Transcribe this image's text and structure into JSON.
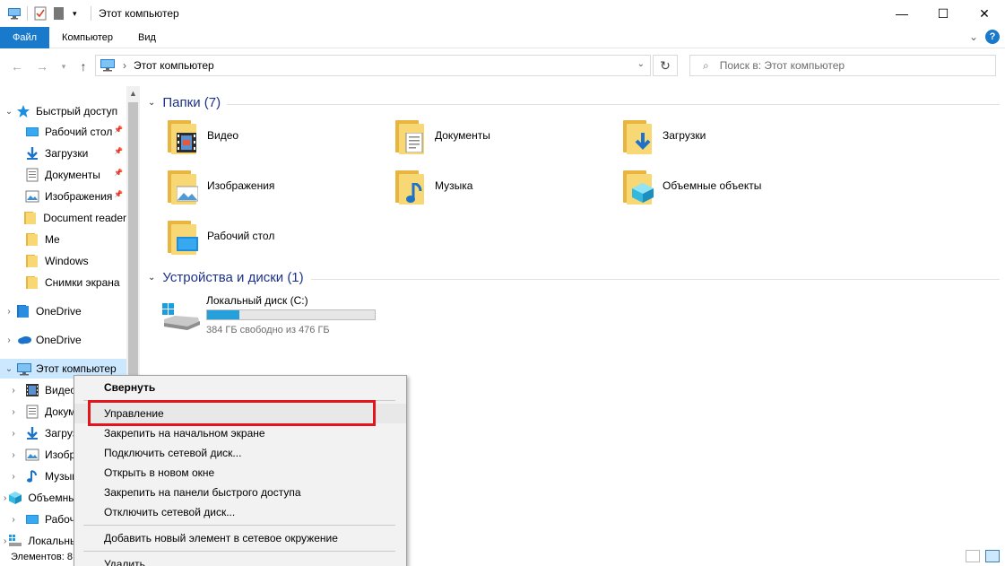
{
  "window": {
    "title": "Этот компьютер",
    "minimize": "—",
    "maximize": "☐",
    "close": "✕"
  },
  "ribbon": {
    "tabs": [
      "Файл",
      "Компьютер",
      "Вид"
    ],
    "collapse": "⌄",
    "help": "?"
  },
  "address": {
    "path": "Этот компьютер",
    "search_placeholder": "Поиск в: Этот компьютер"
  },
  "sidebar": {
    "items": [
      {
        "label": "Быстрый доступ",
        "expander": "v",
        "icon": "star-icon",
        "pinned": false,
        "selected": false
      },
      {
        "label": "Рабочий стол",
        "expander": "",
        "icon": "desktop-icon",
        "pinned": true,
        "selected": false
      },
      {
        "label": "Загрузки",
        "expander": "",
        "icon": "download-icon",
        "pinned": true,
        "selected": false
      },
      {
        "label": "Документы",
        "expander": "",
        "icon": "document-icon",
        "pinned": true,
        "selected": false
      },
      {
        "label": "Изображения",
        "expander": "",
        "icon": "image-icon",
        "pinned": true,
        "selected": false
      },
      {
        "label": "Document reader",
        "expander": "",
        "icon": "folder-icon",
        "pinned": false,
        "selected": false
      },
      {
        "label": "Me",
        "expander": "",
        "icon": "folder-icon",
        "pinned": false,
        "selected": false
      },
      {
        "label": "Windows",
        "expander": "",
        "icon": "folder-icon",
        "pinned": false,
        "selected": false
      },
      {
        "label": "Снимки экрана",
        "expander": "",
        "icon": "folder-icon",
        "pinned": false,
        "selected": false
      },
      {
        "label": "OneDrive",
        "expander": ">",
        "icon": "onedrive-icon",
        "pinned": false,
        "selected": false
      },
      {
        "label": "OneDrive",
        "expander": ">",
        "icon": "onedrive-cloud-icon",
        "pinned": false,
        "selected": false
      },
      {
        "label": "Этот компьютер",
        "expander": "v",
        "icon": "computer-icon",
        "pinned": false,
        "selected": true
      },
      {
        "label": "Видео",
        "expander": ">",
        "icon": "video-icon",
        "pinned": false,
        "selected": false
      },
      {
        "label": "Документы",
        "expander": ">",
        "icon": "document-icon",
        "pinned": false,
        "selected": false
      },
      {
        "label": "Загрузки",
        "expander": ">",
        "icon": "download-icon",
        "pinned": false,
        "selected": false
      },
      {
        "label": "Изображения",
        "expander": ">",
        "icon": "image-icon",
        "pinned": false,
        "selected": false
      },
      {
        "label": "Музыка",
        "expander": ">",
        "icon": "music-icon",
        "pinned": false,
        "selected": false
      },
      {
        "label": "Объемные объекты",
        "expander": ">",
        "icon": "3d-objects-icon",
        "pinned": false,
        "selected": false
      },
      {
        "label": "Рабочий стол",
        "expander": ">",
        "icon": "desktop-icon",
        "pinned": false,
        "selected": false
      },
      {
        "label": "Локальный диск (C:)",
        "expander": ">",
        "icon": "drive-icon",
        "pinned": false,
        "selected": false
      }
    ]
  },
  "main": {
    "folders_header": "Папки (7)",
    "folders": [
      {
        "label": "Видео",
        "icon": "video-folder-icon"
      },
      {
        "label": "Документы",
        "icon": "documents-folder-icon"
      },
      {
        "label": "Загрузки",
        "icon": "downloads-folder-icon"
      },
      {
        "label": "Изображения",
        "icon": "pictures-folder-icon"
      },
      {
        "label": "Музыка",
        "icon": "music-folder-icon"
      },
      {
        "label": "Объемные объекты",
        "icon": "3d-objects-folder-icon"
      },
      {
        "label": "Рабочий стол",
        "icon": "desktop-folder-icon"
      }
    ],
    "drives_header": "Устройства и диски (1)",
    "drive": {
      "name": "Локальный диск (C:)",
      "free_text": "384 ГБ свободно из 476 ГБ",
      "used_fraction": 0.193
    }
  },
  "status": {
    "text": "Элементов: 8"
  },
  "context_menu": {
    "items": [
      {
        "label": "Свернуть",
        "bold": true
      },
      {
        "label": "Управление",
        "bold": false,
        "highlighted": true
      },
      {
        "label": "Закрепить на начальном экране",
        "bold": false
      },
      {
        "label": "Подключить сетевой диск...",
        "bold": false
      },
      {
        "label": "Открыть в новом окне",
        "bold": false
      },
      {
        "label": "Закрепить на панели быстрого доступа",
        "bold": false
      },
      {
        "label": "Отключить сетевой диск...",
        "bold": false
      },
      {
        "label": "Добавить новый элемент в сетевое окружение",
        "bold": false
      },
      {
        "label": "Удалить",
        "bold": false
      }
    ]
  },
  "colors": {
    "accent": "#1979ca",
    "folder": "#f8d775",
    "selection": "#cce8ff",
    "highlight_box": "#e3141c",
    "drive_bar": "#26a0da"
  }
}
